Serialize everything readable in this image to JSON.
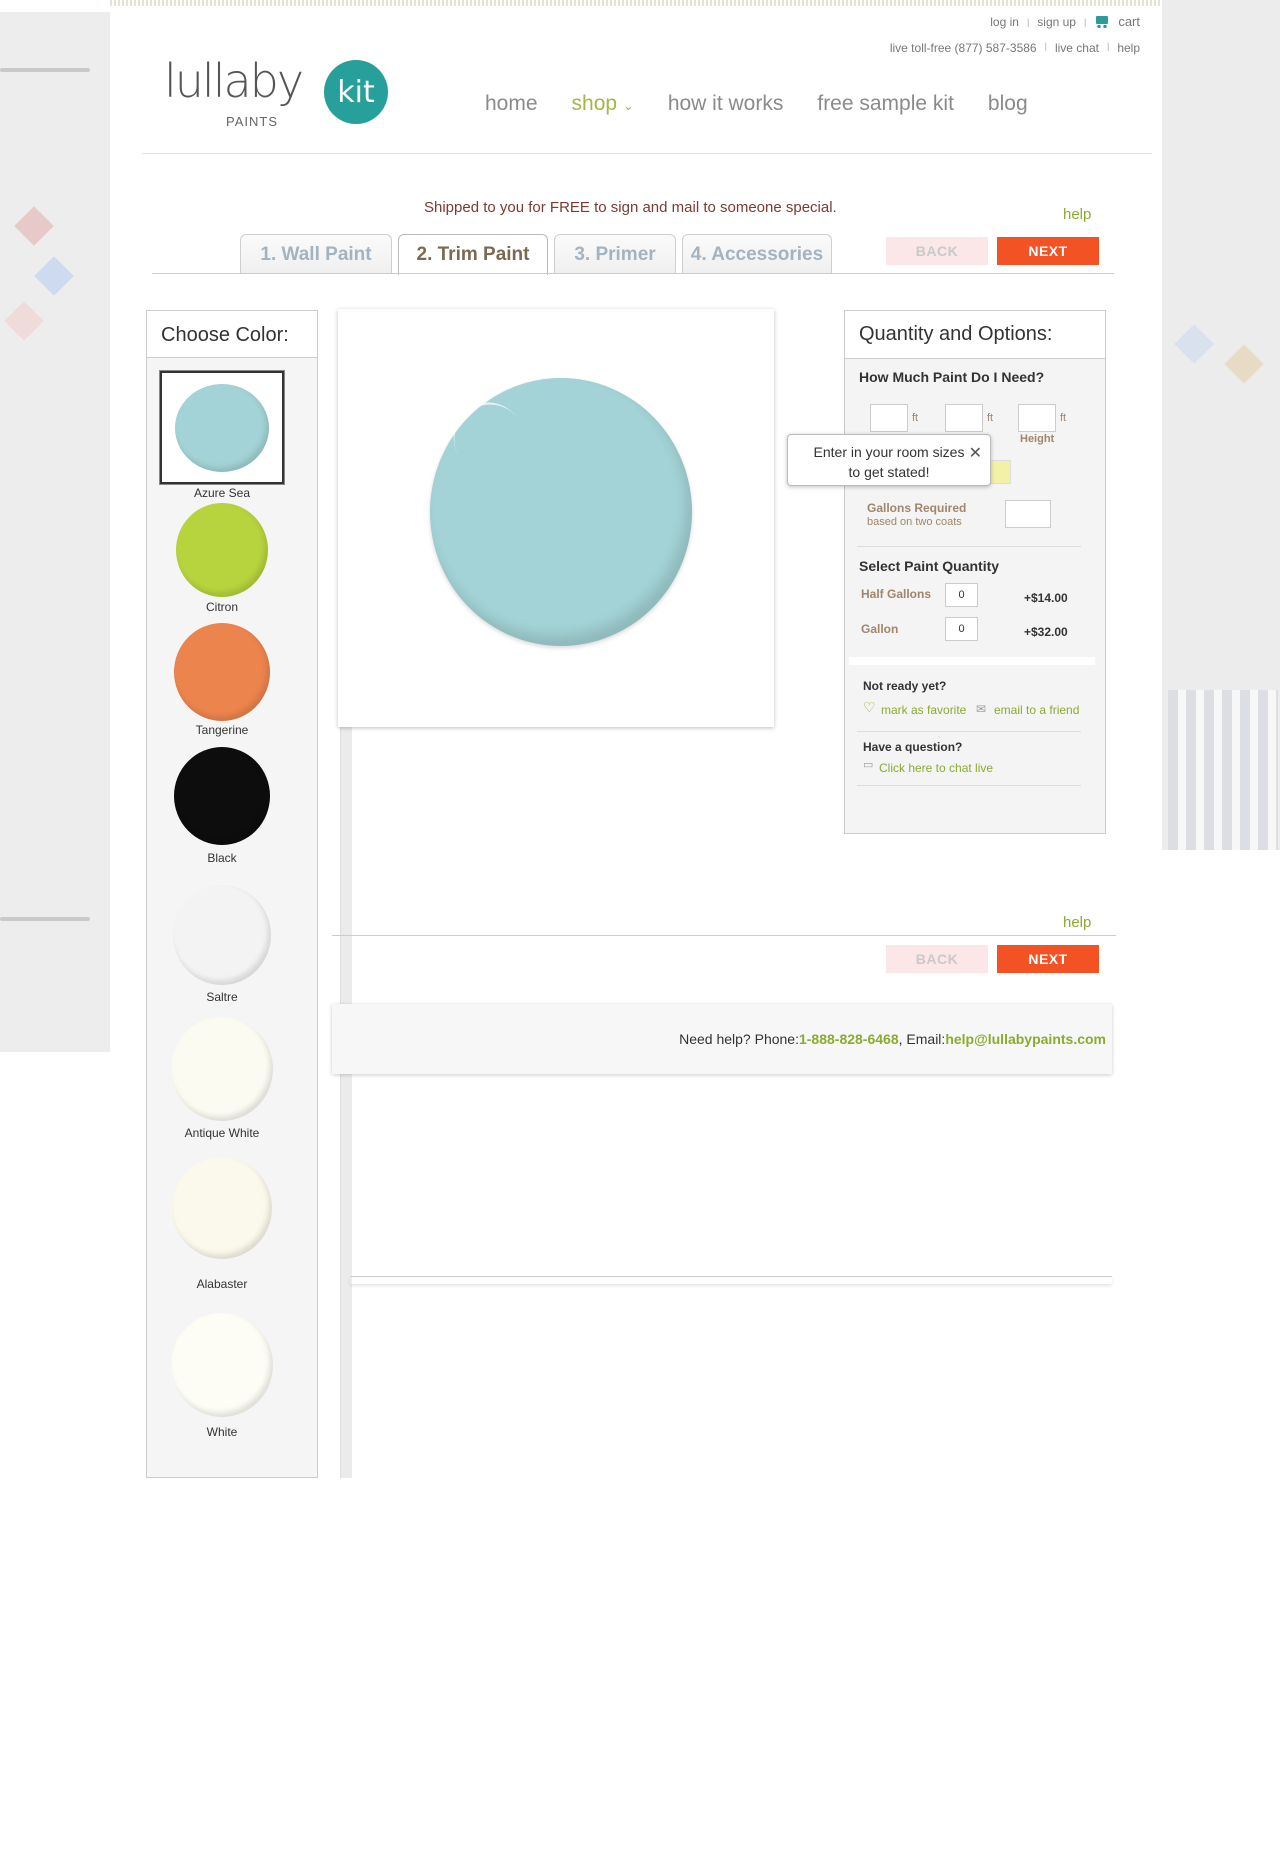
{
  "header": {
    "login": "log in",
    "signup": "sign up",
    "cart": "cart",
    "phone": "live toll-free (877) 587-3586",
    "live_chat": "live chat",
    "help": "help"
  },
  "logo": {
    "word": "lullaby",
    "sub": "PAINTS",
    "badge": "kit"
  },
  "nav": [
    "home",
    "shop",
    "how it works",
    "free sample kit",
    "blog"
  ],
  "shipped_note": "Shipped to you for FREE to sign and mail to someone special.",
  "help_label": "help",
  "tabs": [
    "1. Wall Paint",
    "2. Trim Paint",
    "3. Primer",
    "4. Accessories"
  ],
  "buttons": {
    "back": "BACK",
    "next": "NEXT"
  },
  "colors": {
    "title": "Choose Color:",
    "items": [
      {
        "name": "Azure Sea",
        "hex": "#a3d3d6"
      },
      {
        "name": "Citron",
        "hex": "#b7d33d"
      },
      {
        "name": "Tangerine",
        "hex": "#ec844e"
      },
      {
        "name": "Black",
        "hex": "#0d0d0d"
      },
      {
        "name": "Saltre",
        "hex": "#f3f3f3"
      },
      {
        "name": "Antique White",
        "hex": "#fcfbf2"
      },
      {
        "name": "Alabaster",
        "hex": "#fbf9eb"
      },
      {
        "name": "White",
        "hex": "#fdfdf6"
      }
    ]
  },
  "options": {
    "title": "Quantity and Options:",
    "how_much": "How Much Paint Do I Need?",
    "unit": "ft",
    "height_label": "Height",
    "tooltip_line1": "Enter in your room sizes",
    "tooltip_line2": "to get stated!",
    "gallons_required": "Gallons Required",
    "gallons_note": "based on two coats",
    "select_qty": "Select Paint Quantity",
    "half_gallons_label": "Half Gallons",
    "half_gallons_qty": "0",
    "half_gallons_price": "+$14.00",
    "gallon_label": "Gallon",
    "gallon_qty": "0",
    "gallon_price": "+$32.00",
    "not_ready": "Not ready yet?",
    "mark_favorite": "mark as favorite",
    "email_friend": "email to a friend",
    "question": "Have a question?",
    "chat_live": "Click here to chat live"
  },
  "footer_help": {
    "prefix": "Need help? Phone: ",
    "phone": "1-888-828-6468",
    "email_prefix": ", Email: ",
    "email": "help@lullabypaints.com"
  },
  "accent_colors": {
    "teal": "#279f9a",
    "green": "#8aab2f",
    "orange": "#f25224"
  }
}
